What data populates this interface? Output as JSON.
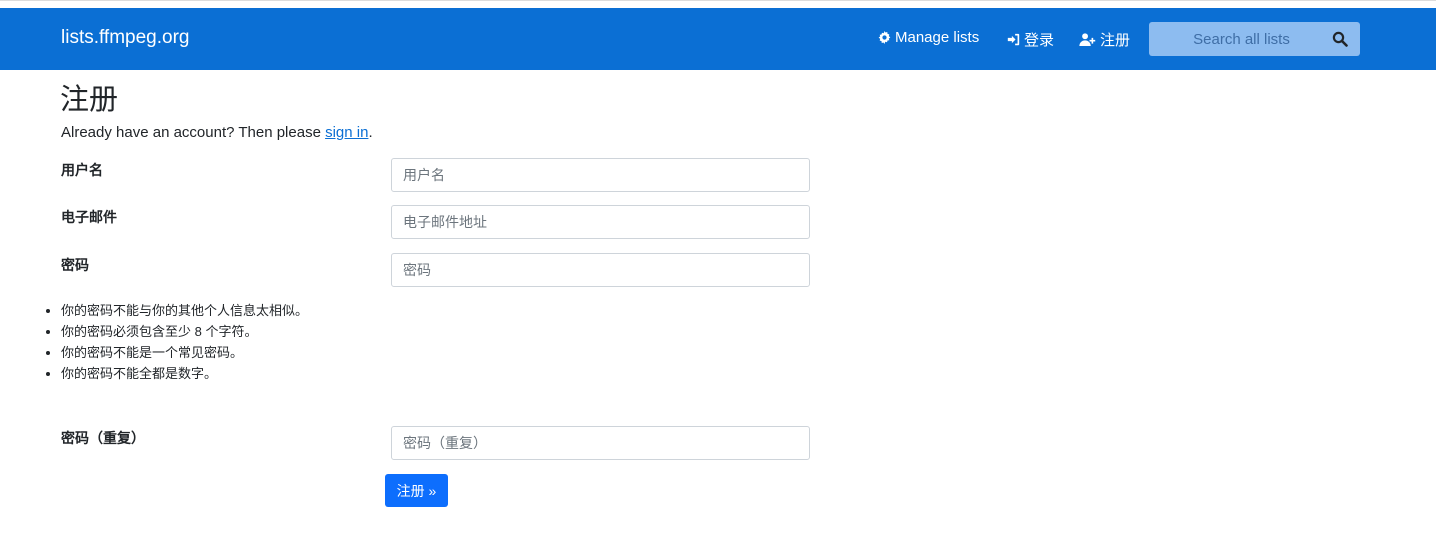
{
  "navbar": {
    "brand": "lists.ffmpeg.org",
    "manage_lists": "Manage lists",
    "login": "登录",
    "register": "注册",
    "search_placeholder": "Search all lists"
  },
  "page": {
    "title": "注册",
    "intro_prefix": "Already have an account? Then please ",
    "intro_link": "sign in",
    "intro_suffix": "."
  },
  "form": {
    "username": {
      "label": "用户名",
      "placeholder": "用户名"
    },
    "email": {
      "label": "电子邮件",
      "placeholder": "电子邮件地址"
    },
    "password": {
      "label": "密码",
      "placeholder": "密码"
    },
    "password_help": [
      "你的密码不能与你的其他个人信息太相似。",
      "你的密码必须包含至少 8 个字符。",
      "你的密码不能是一个常见密码。",
      "你的密码不能全都是数字。"
    ],
    "password_repeat": {
      "label": "密码（重复）",
      "placeholder": "密码（重复）"
    },
    "submit_label": "注册 »"
  },
  "colors": {
    "navbar_bg": "#0b6fd4",
    "search_bg": "#8dbcf0",
    "button_bg": "#0d6efd",
    "link": "#0b6fd4"
  }
}
